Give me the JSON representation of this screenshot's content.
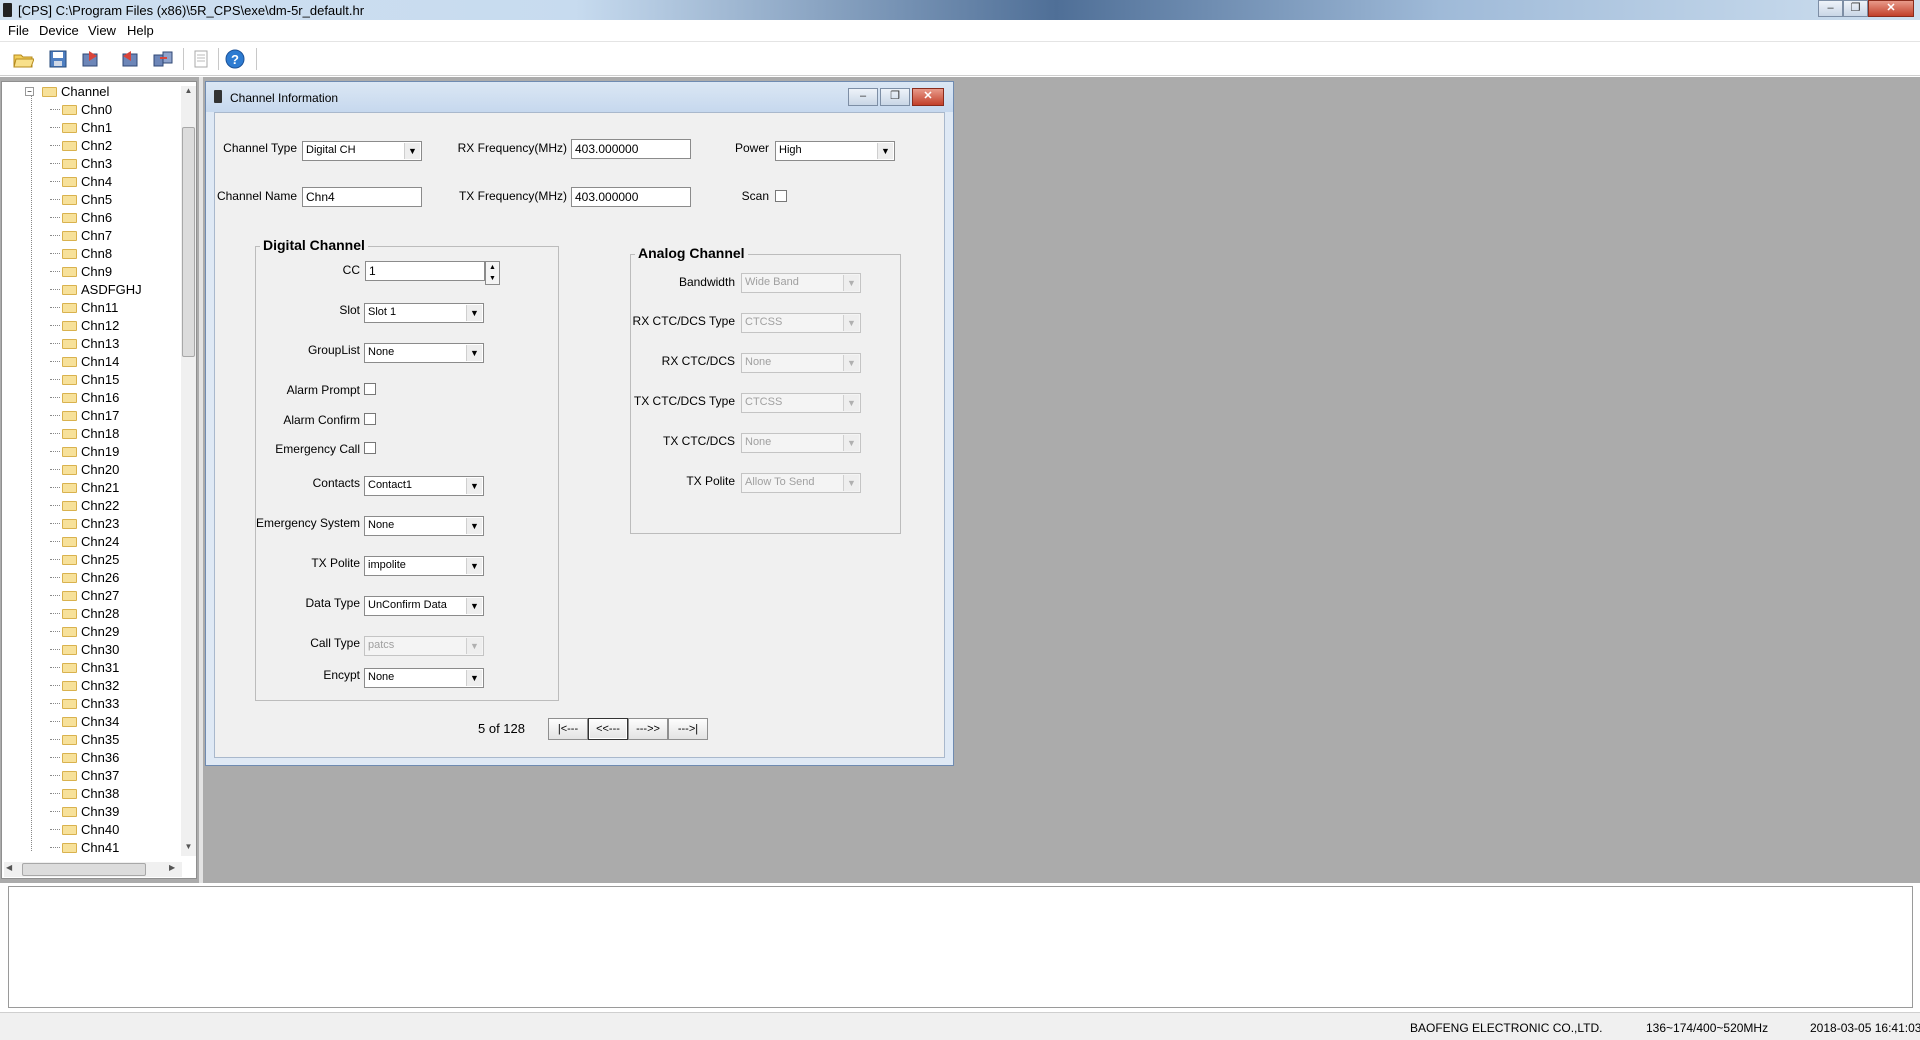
{
  "window": {
    "title": "[CPS]     C:\\Program Files (x86)\\5R_CPS\\exe\\dm-5r_default.hr"
  },
  "menubar": {
    "items": [
      "File",
      "Device",
      "View",
      "Help"
    ]
  },
  "toolbar": {
    "icons": [
      "open-folder-icon",
      "save-icon",
      "read-from-radio-icon",
      "write-to-radio-icon",
      "program-icon",
      "document-icon",
      "help-icon"
    ]
  },
  "tree": {
    "root": "Channel",
    "items": [
      "Chn0",
      "Chn1",
      "Chn2",
      "Chn3",
      "Chn4",
      "Chn5",
      "Chn6",
      "Chn7",
      "Chn8",
      "Chn9",
      "ASDFGHJ",
      "Chn11",
      "Chn12",
      "Chn13",
      "Chn14",
      "Chn15",
      "Chn16",
      "Chn17",
      "Chn18",
      "Chn19",
      "Chn20",
      "Chn21",
      "Chn22",
      "Chn23",
      "Chn24",
      "Chn25",
      "Chn26",
      "Chn27",
      "Chn28",
      "Chn29",
      "Chn30",
      "Chn31",
      "Chn32",
      "Chn33",
      "Chn34",
      "Chn35",
      "Chn36",
      "Chn37",
      "Chn38",
      "Chn39",
      "Chn40",
      "Chn41"
    ]
  },
  "channel_window": {
    "title": "Channel Information",
    "channel_type": {
      "label": "Channel Type",
      "value": "Digital CH"
    },
    "rx_freq": {
      "label": "RX Frequency(MHz)",
      "value": "403.000000"
    },
    "power": {
      "label": "Power",
      "value": "High"
    },
    "channel_name": {
      "label": "Channel Name",
      "value": "Chn4"
    },
    "tx_freq": {
      "label": "TX Frequency(MHz)",
      "value": "403.000000"
    },
    "scan": {
      "label": "Scan",
      "checked": false
    },
    "digital": {
      "title": "Digital Channel",
      "cc": {
        "label": "CC",
        "value": "1"
      },
      "slot": {
        "label": "Slot",
        "value": "Slot 1"
      },
      "grouplist": {
        "label": "GroupList",
        "value": "None"
      },
      "alarm_prompt": {
        "label": "Alarm Prompt",
        "checked": false
      },
      "alarm_confirm": {
        "label": "Alarm Confirm",
        "checked": false
      },
      "emergency_call": {
        "label": "Emergency Call",
        "checked": false
      },
      "contacts": {
        "label": "Contacts",
        "value": "Contact1"
      },
      "emergency_system": {
        "label": "Emergency System",
        "value": "None"
      },
      "tx_polite": {
        "label": "TX Polite",
        "value": "impolite"
      },
      "data_type": {
        "label": "Data Type",
        "value": "UnConfirm Data"
      },
      "call_type": {
        "label": "Call Type",
        "value": "patcs"
      },
      "encrypt": {
        "label": "Encypt",
        "value": "None"
      }
    },
    "analog": {
      "title": "Analog Channel",
      "bandwidth": {
        "label": "Bandwidth",
        "value": "Wide Band"
      },
      "rx_ctc_type": {
        "label": "RX CTC/DCS Type",
        "value": "CTCSS"
      },
      "rx_ctc": {
        "label": "RX CTC/DCS",
        "value": "None"
      },
      "tx_ctc_type": {
        "label": "TX CTC/DCS Type",
        "value": "CTCSS"
      },
      "tx_ctc": {
        "label": "TX CTC/DCS",
        "value": "None"
      },
      "tx_polite": {
        "label": "TX Polite",
        "value": "Allow To Send"
      }
    },
    "pager": {
      "text": "5   of 128",
      "first": "|<---",
      "prev": "<<---",
      "next": "--->>",
      "last": "--->|"
    }
  },
  "statusbar": {
    "company": "BAOFENG ELECTRONIC CO.,LTD.",
    "range": "136~174/400~520MHz",
    "datetime": "2018-03-05  16:41:03"
  },
  "colors": {
    "workspace": "#ababab",
    "window_frame": "#dfe9f5",
    "close_button": "#c2402a"
  }
}
